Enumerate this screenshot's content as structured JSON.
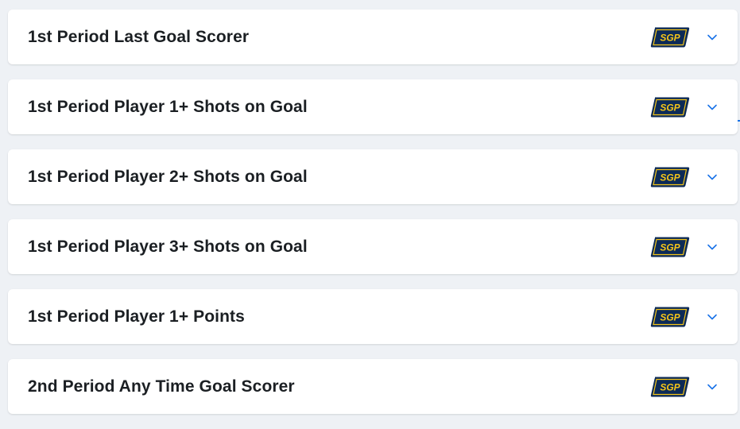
{
  "markets": [
    {
      "title": "1st Period Last Goal Scorer",
      "badge": "SGP"
    },
    {
      "title": "1st Period Player 1+ Shots on Goal",
      "badge": "SGP"
    },
    {
      "title": "1st Period Player 2+ Shots on Goal",
      "badge": "SGP"
    },
    {
      "title": "1st Period Player 3+ Shots on Goal",
      "badge": "SGP"
    },
    {
      "title": "1st Period Player 1+ Points",
      "badge": "SGP"
    },
    {
      "title": "2nd Period Any Time Goal Scorer",
      "badge": "SGP"
    }
  ],
  "icons": {
    "badge": "sgp-badge-icon",
    "expand": "chevron-down-icon"
  },
  "colors": {
    "page_background": "#eef1f5",
    "card_background": "#ffffff",
    "title_text": "#1b1f23",
    "badge_fill": "#0c2a57",
    "badge_text": "#f5c518",
    "chevron": "#1a73e8"
  }
}
